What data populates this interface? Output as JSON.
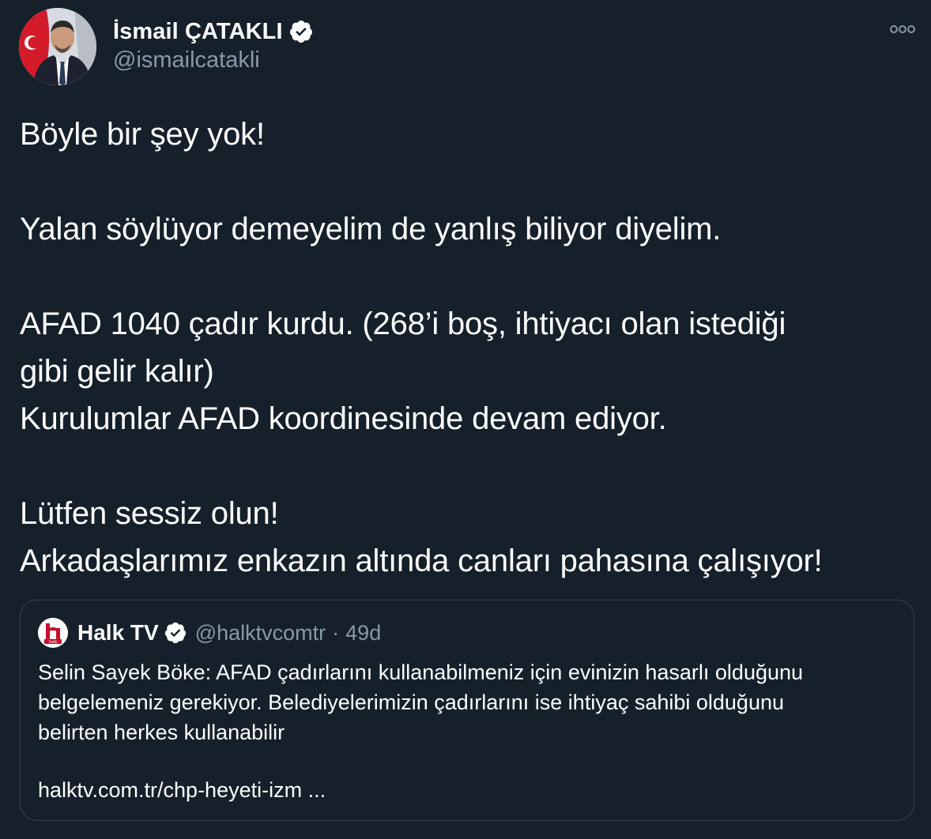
{
  "author": {
    "name": "İsmail ÇATAKLI",
    "handle": "@ismailcatakli",
    "verified": true,
    "avatar_icon": "profile-photo"
  },
  "more_icon": "more-options-icon",
  "tweet": {
    "lines": [
      "Böyle bir şey yok!",
      "",
      "Yalan söylüyor demeyelim de yanlış biliyor diyelim.",
      "",
      "AFAD 1040 çadır kurdu. (268’i boş, ihtiyacı olan istediği",
      "gibi gelir kalır)",
      "Kurulumlar AFAD koordinesinde devam ediyor.",
      "",
      "Lütfen sessiz olun!",
      "Arkadaşlarımız enkazın altında canları pahasına çalışıyor!"
    ]
  },
  "quote": {
    "name": "Halk TV",
    "handle": "@halktvcomtr",
    "separator": "·",
    "time": "49d",
    "verified": true,
    "lines": [
      "Selin Sayek Böke: AFAD çadırlarını kullanabilmeniz için evinizin hasarlı olduğunu",
      "belgelemeniz gerekiyor. Belediyelerimizin çadırlarını ise ihtiyaç sahibi olduğunu",
      "belirten herkes kullanabilir"
    ],
    "link": "halktv.com.tr/chp-heyeti-izm  ..."
  },
  "colors": {
    "background": "#15202b",
    "text": "#ffffff",
    "secondary": "#8899a6",
    "border": "#38444d",
    "logo_red": "#c8102e"
  }
}
